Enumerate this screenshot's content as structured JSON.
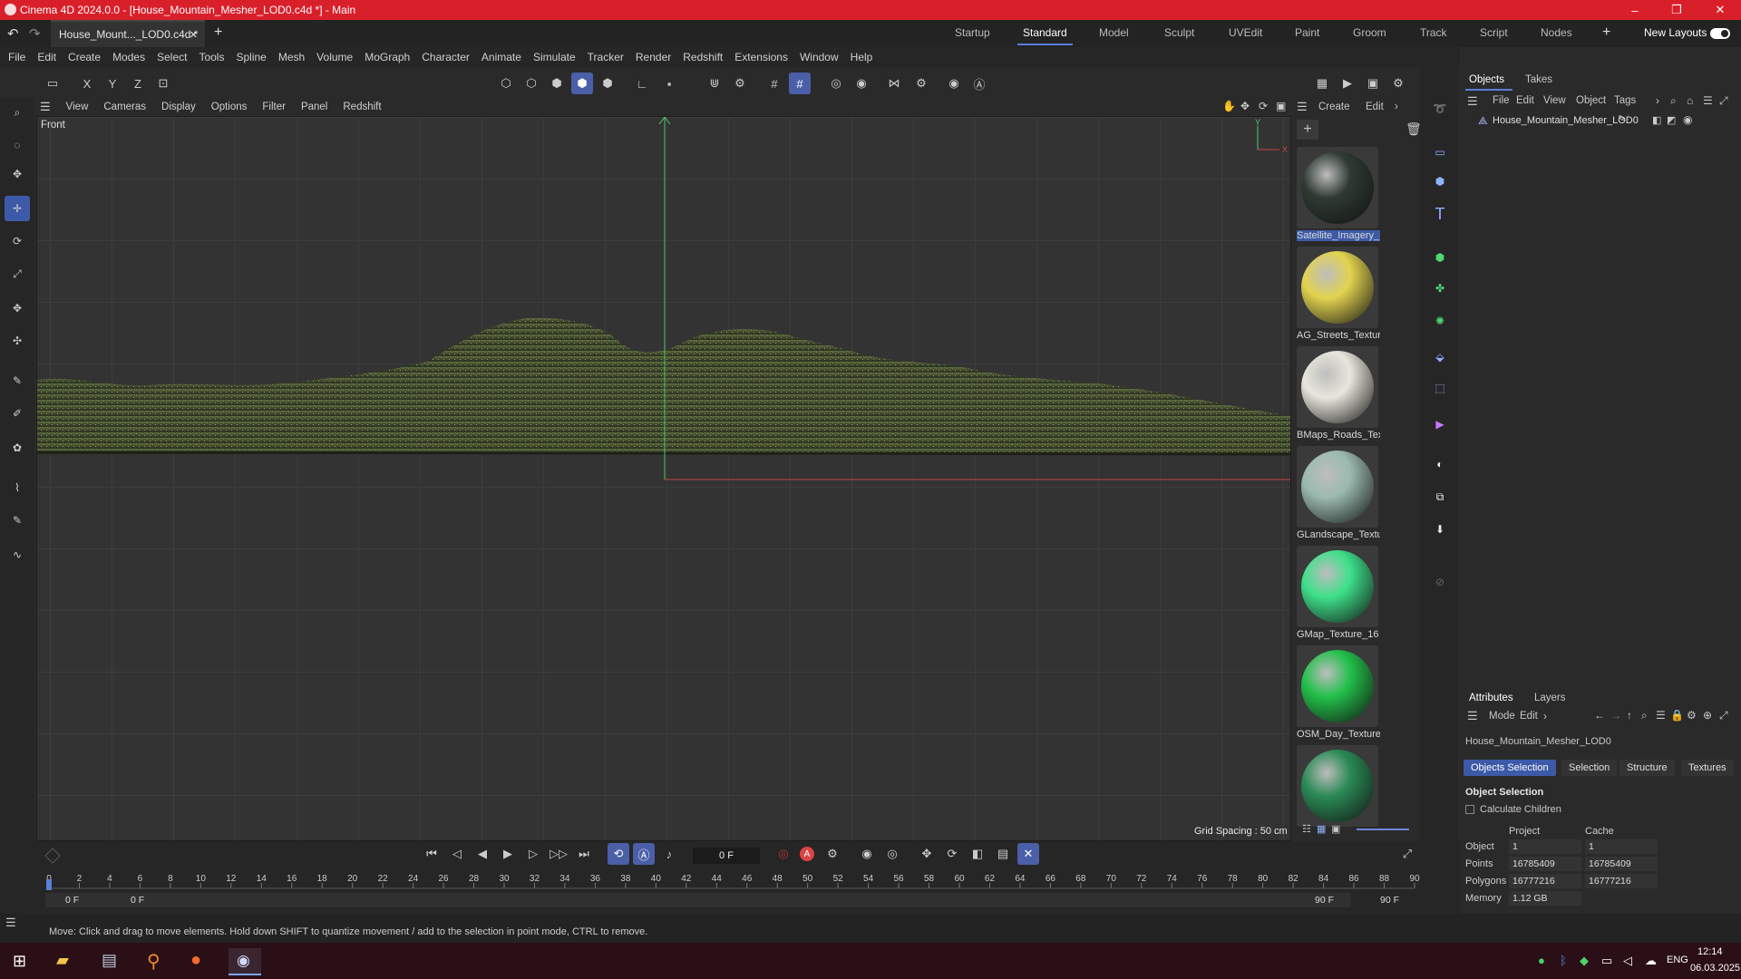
{
  "window": {
    "title": "Cinema 4D 2024.0.0 - [House_Mountain_Mesher_LOD0.c4d *] - Main",
    "controls": [
      "–",
      "❐",
      "✕"
    ]
  },
  "tabs": {
    "doc_tab": "House_Mount..._LOD0.c4d *",
    "doc_close": "✕",
    "add": "+",
    "layouts": [
      "Startup",
      "Standard",
      "Model",
      "Sculpt",
      "UVEdit",
      "Paint",
      "Groom",
      "Track",
      "Script",
      "Nodes"
    ],
    "active_layout": "Standard",
    "new_layouts": "New Layouts"
  },
  "menu": [
    "File",
    "Edit",
    "Create",
    "Modes",
    "Select",
    "Tools",
    "Spline",
    "Mesh",
    "Volume",
    "MoGraph",
    "Character",
    "Animate",
    "Simulate",
    "Tracker",
    "Render",
    "Redshift",
    "Extensions",
    "Window",
    "Help"
  ],
  "toolbar": {
    "axis_x": "X",
    "axis_y": "Y",
    "axis_z": "Z"
  },
  "viewport": {
    "menu": [
      "View",
      "Cameras",
      "Display",
      "Options",
      "Filter",
      "Panel",
      "Redshift"
    ],
    "view_name": "Front",
    "grid_spacing": "Grid Spacing : 50 cm"
  },
  "materials": {
    "menu": [
      "Create",
      "Edit"
    ],
    "items": [
      {
        "label": "Satellite_Imagery_",
        "color": "#2f3a32"
      },
      {
        "label": "AG_Streets_Textur",
        "color": "#e2d34f"
      },
      {
        "label": "BMaps_Roads_Tex",
        "color": "#e8e6dc"
      },
      {
        "label": "GLandscape_Textu",
        "color": "#9bbab0"
      },
      {
        "label": "GMap_Texture_16",
        "color": "#3ee08a"
      },
      {
        "label": "OSM_Day_Texture",
        "color": "#22c04a"
      },
      {
        "label": "",
        "color": "#2a8a55"
      }
    ]
  },
  "objects": {
    "tabs": [
      "Objects",
      "Takes"
    ],
    "menu": [
      "File",
      "Edit",
      "View",
      "Object",
      "Tags"
    ],
    "item": "House_Mountain_Mesher_LOD0"
  },
  "attributes": {
    "tabs": [
      "Attributes",
      "Layers"
    ],
    "menu": [
      "Mode",
      "Edit"
    ],
    "object_name": "House_Mountain_Mesher_LOD0",
    "sub_tabs": [
      "Objects Selection",
      "Selection",
      "Structure",
      "Textures"
    ],
    "section": "Object Selection",
    "calc_children": "Calculate Children",
    "col_project": "Project",
    "col_cache": "Cache",
    "rows": [
      {
        "label": "Object",
        "project": "1",
        "cache": "1"
      },
      {
        "label": "Points",
        "project": "16785409",
        "cache": "16785409"
      },
      {
        "label": "Polygons",
        "project": "16777216",
        "cache": "16777216"
      },
      {
        "label": "Memory",
        "project": "1.12 GB",
        "cache": ""
      }
    ]
  },
  "timeline": {
    "frame": "0 F",
    "ticks": [
      "0",
      "2",
      "4",
      "6",
      "8",
      "10",
      "12",
      "14",
      "16",
      "18",
      "20",
      "22",
      "24",
      "26",
      "28",
      "30",
      "32",
      "34",
      "36",
      "38",
      "40",
      "42",
      "44",
      "46",
      "48",
      "50",
      "52",
      "54",
      "56",
      "58",
      "60",
      "62",
      "64",
      "66",
      "68",
      "70",
      "72",
      "74",
      "76",
      "78",
      "80",
      "82",
      "84",
      "86",
      "88",
      "90"
    ],
    "start": "0 F",
    "start2": "0 F",
    "end": "90 F",
    "end2": "90 F"
  },
  "status": "Move: Click and drag to move elements. Hold down SHIFT to quantize movement / add to the selection in point mode, CTRL to remove.",
  "taskbar": {
    "lang": "ENG",
    "time": "12:14",
    "date": "06.03.2025"
  }
}
